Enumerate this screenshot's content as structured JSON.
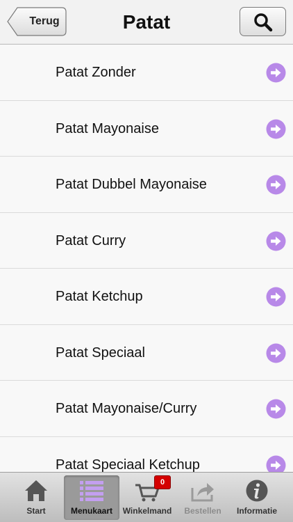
{
  "navbar": {
    "back_label": "Terug",
    "title": "Patat"
  },
  "list": {
    "items": [
      {
        "label": "Patat Zonder"
      },
      {
        "label": "Patat Mayonaise"
      },
      {
        "label": "Patat Dubbel Mayonaise"
      },
      {
        "label": "Patat Curry"
      },
      {
        "label": "Patat Ketchup"
      },
      {
        "label": "Patat Speciaal"
      },
      {
        "label": "Patat Mayonaise/Curry"
      },
      {
        "label": "Patat Speciaal Ketchup"
      }
    ],
    "arrow_icon": "right-arrow-circle-icon",
    "arrow_color": "#b889e8"
  },
  "tabbar": {
    "tabs": [
      {
        "label": "Start",
        "icon": "home-icon"
      },
      {
        "label": "Menukaart",
        "icon": "list-icon",
        "active": true
      },
      {
        "label": "Winkelmand",
        "icon": "cart-icon",
        "badge": "0"
      },
      {
        "label": "Bestellen",
        "icon": "share-icon",
        "disabled": true
      },
      {
        "label": "Informatie",
        "icon": "info-icon"
      }
    ]
  },
  "colors": {
    "accent": "#b889e8",
    "badge": "#d40000"
  }
}
